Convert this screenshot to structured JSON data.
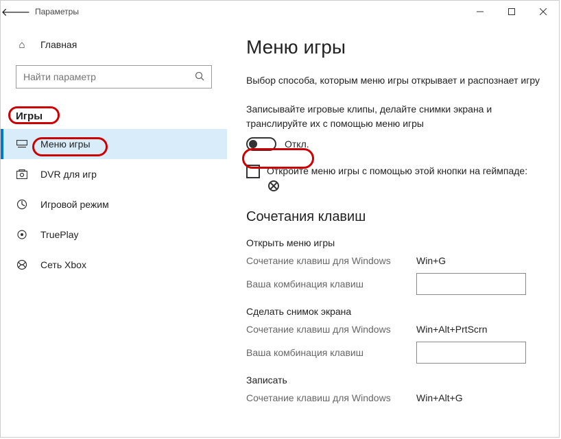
{
  "title": "Параметры",
  "sidebar": {
    "home": "Главная",
    "search_placeholder": "Найти параметр",
    "category": "Игры",
    "items": [
      {
        "label": "Меню игры"
      },
      {
        "label": "DVR для игр"
      },
      {
        "label": "Игровой режим"
      },
      {
        "label": "TruePlay"
      },
      {
        "label": "Сеть Xbox"
      }
    ]
  },
  "main": {
    "heading": "Меню игры",
    "desc": "Выбор способа, которым меню игры открывает и распознает игру",
    "toggle_label": "Записывайте игровые клипы, делайте снимки экрана и транслируйте их с помощью меню игры",
    "toggle_state": "Откл.",
    "checkbox_label": "Откройте меню игры с помощью этой кнопки на геймпаде:",
    "shortcuts_heading": "Сочетания клавиш",
    "win_label": "Сочетание клавиш для Windows",
    "custom_label": "Ваша комбинация клавиш",
    "groups": [
      {
        "title": "Открыть меню игры",
        "win_value": "Win+G"
      },
      {
        "title": "Сделать снимок экрана",
        "win_value": "Win+Alt+PrtScrn"
      },
      {
        "title": "Записать",
        "win_value": "Win+Alt+G"
      }
    ]
  }
}
